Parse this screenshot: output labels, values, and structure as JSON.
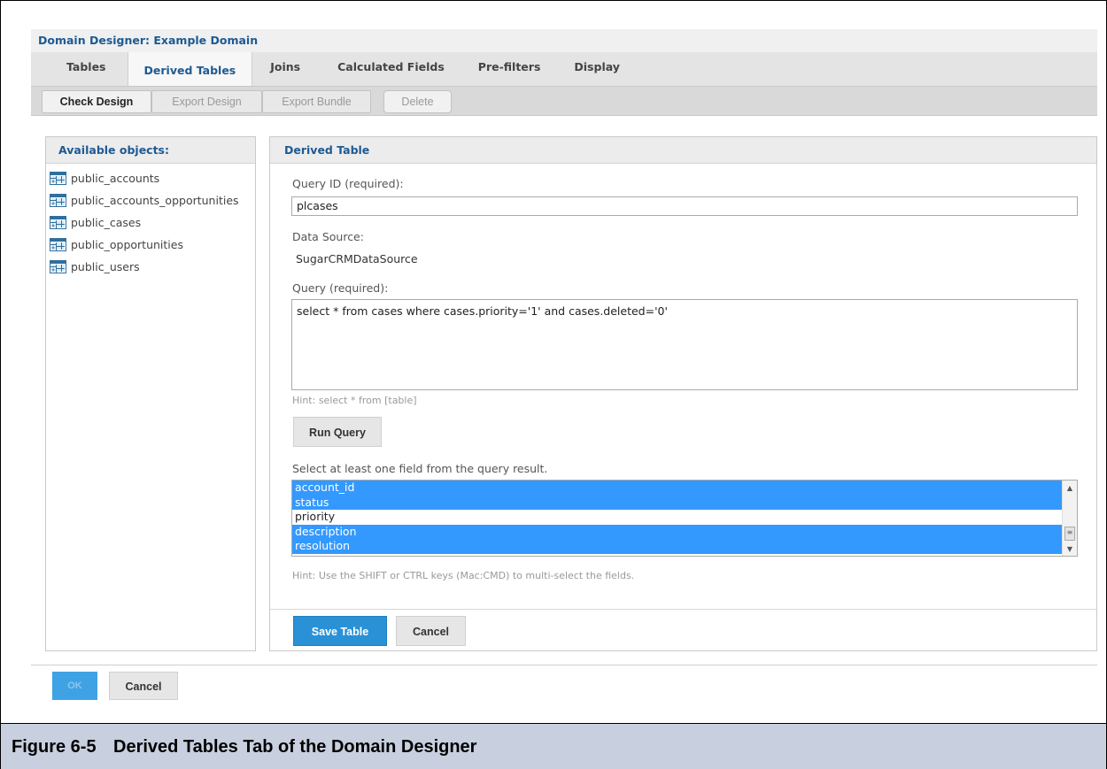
{
  "designer": {
    "title": "Domain Designer: Example Domain"
  },
  "tabs": [
    {
      "label": "Tables"
    },
    {
      "label": "Derived Tables"
    },
    {
      "label": "Joins"
    },
    {
      "label": "Calculated Fields"
    },
    {
      "label": "Pre-filters"
    },
    {
      "label": "Display"
    }
  ],
  "active_tab": "Derived Tables",
  "toolbar": {
    "check_design": "Check Design",
    "export_design": "Export Design",
    "export_bundle": "Export Bundle",
    "delete": "Delete"
  },
  "available": {
    "title": "Available objects:",
    "items": [
      {
        "label": "public_accounts",
        "icon": "table-icon"
      },
      {
        "label": "public_accounts_opportunities",
        "icon": "table-icon"
      },
      {
        "label": "public_cases",
        "icon": "table-icon"
      },
      {
        "label": "public_opportunities",
        "icon": "table-icon"
      },
      {
        "label": "public_users",
        "icon": "table-icon"
      }
    ]
  },
  "derived": {
    "title": "Derived Table",
    "query_id_label": "Query ID (required):",
    "query_id_value": "plcases",
    "data_source_label": "Data Source:",
    "data_source_value": "SugarCRMDataSource",
    "query_label": "Query (required):",
    "query_value": "select * from cases where cases.priority='1' and cases.deleted='0'",
    "query_hint": "Hint: select * from [table]",
    "run_query": "Run Query",
    "fields_label": "Select at least one field from the query result.",
    "fields": [
      {
        "label": "account_id",
        "selected": true
      },
      {
        "label": "status",
        "selected": true
      },
      {
        "label": "priority",
        "selected": false
      },
      {
        "label": "description",
        "selected": true
      },
      {
        "label": "resolution",
        "selected": true
      }
    ],
    "fields_hint": "Hint: Use the SHIFT or CTRL keys (Mac:CMD) to multi-select the fields.",
    "save_table": "Save Table",
    "cancel": "Cancel"
  },
  "footer": {
    "ok": "OK",
    "cancel": "Cancel"
  },
  "caption": {
    "number": "Figure 6-5",
    "text": "Derived Tables Tab of the Domain Designer"
  },
  "colors": {
    "accent": "#1d5a92",
    "primary_button": "#2a91d6",
    "selection": "#3399ff",
    "caption_bg": "#c8d0df"
  }
}
